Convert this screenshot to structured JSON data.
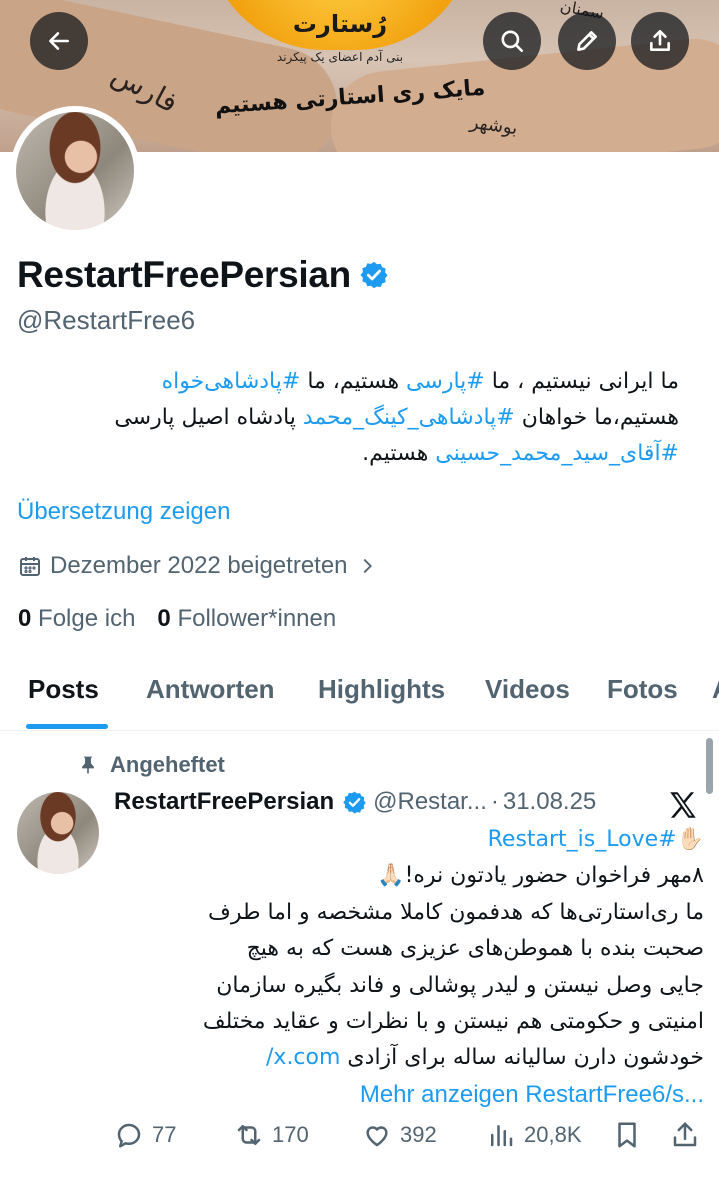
{
  "banner": {
    "logo_text": "رُستارت",
    "subtitle": "بنی آدم اعضای یک پیکرند",
    "slogan": "مایک ری استارتی هستیم",
    "handwriting_left": "فارس",
    "handwriting_right": "بوشهر",
    "handwriting_top": "سمنان"
  },
  "profile": {
    "name": "RestartFreePersian",
    "handle": "@RestartFree6",
    "bio_lines": [
      [
        "ما ایرانی نیستیم ، ما ",
        "#پارسی",
        " هستیم، ما ",
        "#پادشاهی‌خواه"
      ],
      [
        "هستیم،ما خواهان ",
        "#پادشاهی_کینگ_محمد",
        " پادشاه اصیل پارسی"
      ],
      [
        "#آقای_سید_محمد_حسینی",
        " هستیم."
      ]
    ],
    "translate": "Übersetzung zeigen",
    "joined": "Dezember 2022 beigetreten",
    "following_count": "0",
    "following_label": "Folge ich",
    "followers_count": "0",
    "followers_label": "Follower*innen"
  },
  "tabs": [
    "Posts",
    "Antworten",
    "Highlights",
    "Videos",
    "Fotos",
    "A"
  ],
  "active_tab": "Posts",
  "post": {
    "pinned_label": "Angeheftet",
    "name": "RestartFreePersian",
    "handle": "@Restar...",
    "dot": "·",
    "date": "31.08.25",
    "line1_emoji": "✋🏻",
    "line1_tag": "#Restart_is_Love",
    "line2": "۸مهر فراخوان حضور یادتون نره!🙏🏻",
    "line3": "ما ری‌استارتی‌ها که هدفمون کاملا مشخصه و اما طرف",
    "line4": "صحبت بنده با هموطن‌های عزیزی هست که به هیچ",
    "line5": "جایی وصل نیستن و لیدر پوشالی و فاند بگیره سازمان",
    "line6": "امنیتی و حکومتی هم نیستن و با نظرات و عقاید مختلف",
    "line7_text": "خودشون دارن سالیانه ساله برای آزادی",
    "line7_link": "x.com/",
    "more_label": "Mehr anzeigen",
    "more_link": "RestartFree6/s...",
    "replies": "77",
    "reposts": "170",
    "likes": "392",
    "views": "20,8K"
  },
  "colors": {
    "accent": "#1d9bf0",
    "secondary_text": "#536471",
    "text": "#0f1419"
  },
  "icons": [
    "back-arrow-icon",
    "search-icon",
    "edit-pencil-icon",
    "share-icon",
    "verified-badge-icon",
    "calendar-icon",
    "chevron-right-icon",
    "pin-icon",
    "x-logo-icon",
    "reply-icon",
    "repost-icon",
    "like-icon",
    "views-icon",
    "bookmark-icon"
  ]
}
